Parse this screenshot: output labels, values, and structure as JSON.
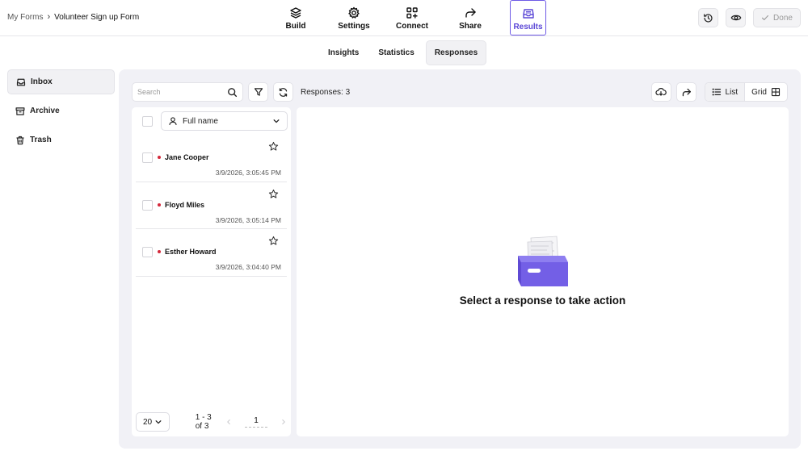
{
  "breadcrumb": {
    "root": "My Forms",
    "separator": "›",
    "current": "Volunteer Sign up Form"
  },
  "nav": [
    {
      "label": "Build",
      "icon": "layers-icon"
    },
    {
      "label": "Settings",
      "icon": "gear-icon"
    },
    {
      "label": "Connect",
      "icon": "qr-plus-icon"
    },
    {
      "label": "Share",
      "icon": "share-arrow-icon"
    },
    {
      "label": "Results",
      "icon": "inbox-icon",
      "active": true
    }
  ],
  "top_actions": {
    "done_label": "Done"
  },
  "subtabs": [
    {
      "label": "Insights"
    },
    {
      "label": "Statistics"
    },
    {
      "label": "Responses",
      "active": true
    }
  ],
  "sidebar": {
    "items": [
      {
        "label": "Inbox",
        "icon": "inbox-icon",
        "active": true
      },
      {
        "label": "Archive",
        "icon": "archive-icon"
      },
      {
        "label": "Trash",
        "icon": "trash-icon"
      }
    ]
  },
  "toolbar": {
    "search_placeholder": "Search",
    "responses_count": "Responses: 3",
    "view_list": "List",
    "view_grid": "Grid"
  },
  "list": {
    "sort_label": "Full name",
    "rows": [
      {
        "name": "Jane Cooper",
        "date": "3/9/2026, 3:05:45 PM"
      },
      {
        "name": "Floyd Miles",
        "date": "3/9/2026, 3:05:14 PM"
      },
      {
        "name": "Esther Howard",
        "date": "3/9/2026, 3:04:40 PM"
      }
    ],
    "page_size": "20",
    "range": "1 - 3 of 3",
    "page": "1"
  },
  "detail": {
    "empty_message": "Select a response to take action"
  },
  "colors": {
    "accent": "#6e5ae6",
    "unread_dot": "#d4283b",
    "panel_bg": "#f1f1f6"
  }
}
